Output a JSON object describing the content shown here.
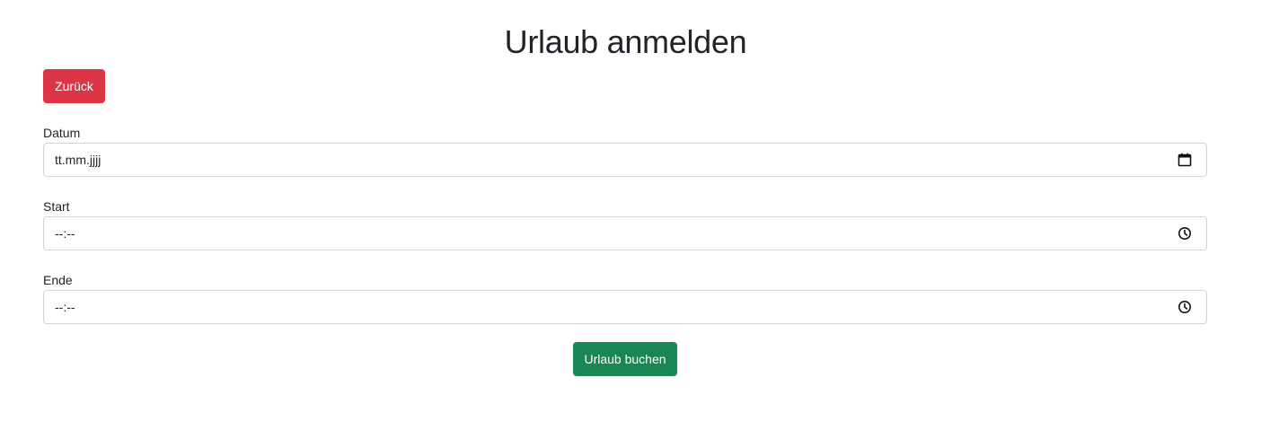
{
  "page": {
    "title": "Urlaub anmelden"
  },
  "actions": {
    "back_label": "Zurück",
    "submit_label": "Urlaub buchen"
  },
  "form": {
    "date": {
      "label": "Datum",
      "value": "tt.mm.jjjj",
      "icon": "calendar-icon"
    },
    "start": {
      "label": "Start",
      "value": "--:--",
      "icon": "clock-icon"
    },
    "end": {
      "label": "Ende",
      "value": "--:--",
      "icon": "clock-icon"
    }
  },
  "colors": {
    "back_button": "#dc3545",
    "submit_button": "#198754",
    "input_border": "#ced4da",
    "text": "#212529"
  }
}
